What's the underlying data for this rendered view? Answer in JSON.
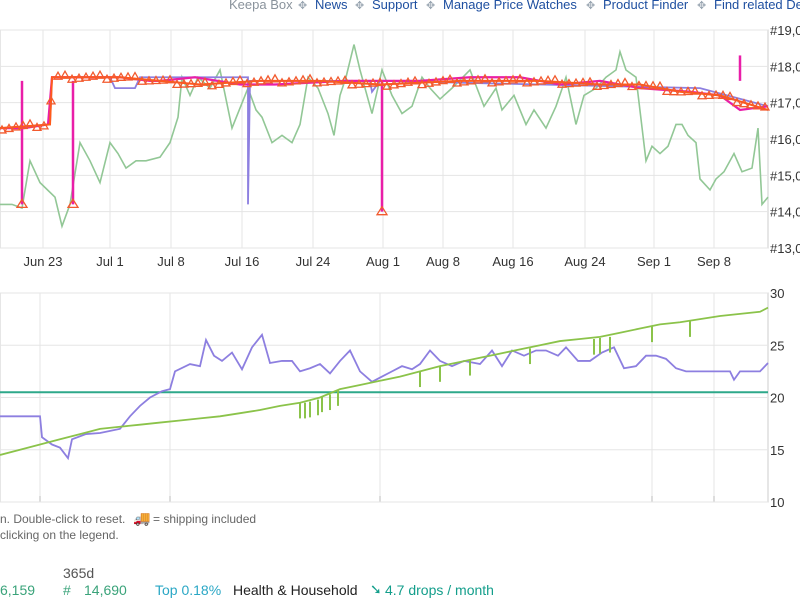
{
  "nav": {
    "items": [
      {
        "label": "Keepa Box",
        "color": "#8a939c"
      },
      {
        "label": "News",
        "color": "#1e4fa0"
      },
      {
        "label": "Support",
        "color": "#1e4fa0"
      },
      {
        "label": "Manage Price Watches",
        "color": "#1e4fa0"
      },
      {
        "label": "Product Finder",
        "color": "#1e4fa0"
      },
      {
        "label": "Find related De",
        "color": "#1e4fa0"
      }
    ]
  },
  "notes": {
    "line1": "n. Double-click to reset.",
    "shipping": "= shipping included",
    "line2": "clicking on the legend."
  },
  "stats": {
    "left_value": "6,159",
    "period": "365d",
    "rank_prefix": "#",
    "rank_value": "14,690",
    "top_percent": "Top 0.18%",
    "category": "Health & Household",
    "drops": "4.7 drops / month"
  },
  "chart_data": [
    {
      "type": "line",
      "name": "sales-rank",
      "x_ticks": [
        "Jun 23",
        "Jul 1",
        "Jul 8",
        "Jul 16",
        "Jul 24",
        "Aug 1",
        "Aug 8",
        "Aug 16",
        "Aug 24",
        "Sep 1",
        "Sep 8"
      ],
      "y_ticks": [
        "#19,0",
        "#18,0",
        "#17,0",
        "#16,0",
        "#15,0",
        "#14,0",
        "#13,0"
      ],
      "ylim": [
        13000,
        19000
      ],
      "series": [
        {
          "color": "#e91ea8",
          "points": [
            [
              0,
              16.3
            ],
            [
              8,
              16.3
            ],
            [
              12,
              16.3
            ],
            [
              24,
              16.3
            ],
            [
              48,
              16.4
            ],
            [
              52,
              17.7
            ],
            [
              74,
              17.7
            ],
            [
              80,
              17.7
            ],
            [
              120,
              17.7
            ],
            [
              150,
              17.6
            ],
            [
              160,
              17.6
            ],
            [
              195,
              17.7
            ],
            [
              240,
              17.5
            ],
            [
              275,
              17.5
            ],
            [
              345,
              17.6
            ],
            [
              380,
              17.6
            ],
            [
              420,
              17.6
            ],
            [
              470,
              17.7
            ],
            [
              520,
              17.7
            ],
            [
              560,
              17.5
            ],
            [
              600,
              17.6
            ],
            [
              640,
              17.4
            ],
            [
              690,
              17.3
            ],
            [
              720,
              17.2
            ],
            [
              740,
              16.8
            ],
            [
              768,
              16.9
            ]
          ],
          "spikes": [
            [
              22,
              14.2
            ],
            [
              73,
              14.2
            ],
            [
              382,
              14.0
            ],
            [
              740,
              18.3
            ]
          ]
        },
        {
          "color": "#ff5a1a",
          "points": [
            [
              0,
              16.3
            ],
            [
              50,
              16.4
            ],
            [
              52,
              17.7
            ],
            [
              120,
              17.7
            ],
            [
              200,
              17.5
            ],
            [
              260,
              17.6
            ],
            [
              320,
              17.6
            ],
            [
              380,
              17.5
            ],
            [
              460,
              17.6
            ],
            [
              540,
              17.6
            ],
            [
              600,
              17.5
            ],
            [
              640,
              17.5
            ],
            [
              680,
              17.3
            ],
            [
              720,
              17.2
            ],
            [
              768,
              16.8
            ]
          ]
        },
        {
          "color": "#8d7fe0",
          "points": [
            [
              0,
              16.3
            ],
            [
              50,
              16.4
            ],
            [
              52,
              17.7
            ],
            [
              110,
              17.7
            ],
            [
              115,
              17.4
            ],
            [
              135,
              17.4
            ],
            [
              140,
              17.7
            ],
            [
              248,
              17.7
            ],
            [
              248,
              14.2
            ],
            [
              250,
              17.6
            ],
            [
              370,
              17.6
            ],
            [
              372,
              17.3
            ],
            [
              380,
              17.6
            ],
            [
              700,
              17.4
            ],
            [
              768,
              16.9
            ]
          ]
        },
        {
          "color": "#92c796",
          "points": [
            [
              0,
              14.2
            ],
            [
              10,
              14.2
            ],
            [
              12,
              14.2
            ],
            [
              22,
              14.1
            ],
            [
              30,
              15.4
            ],
            [
              40,
              14.8
            ],
            [
              55,
              14.4
            ],
            [
              62,
              13.6
            ],
            [
              70,
              14.2
            ],
            [
              80,
              15.9
            ],
            [
              90,
              15.4
            ],
            [
              100,
              14.8
            ],
            [
              110,
              15.9
            ],
            [
              118,
              15.6
            ],
            [
              126,
              15.2
            ],
            [
              136,
              15.4
            ],
            [
              146,
              15.4
            ],
            [
              160,
              15.5
            ],
            [
              170,
              15.9
            ],
            [
              178,
              16.6
            ],
            [
              182,
              17.7
            ],
            [
              190,
              17.2
            ],
            [
              198,
              17.7
            ],
            [
              210,
              17.4
            ],
            [
              220,
              17.9
            ],
            [
              232,
              16.3
            ],
            [
              248,
              17.4
            ],
            [
              256,
              16.8
            ],
            [
              262,
              16.6
            ],
            [
              272,
              15.9
            ],
            [
              282,
              16.1
            ],
            [
              292,
              15.9
            ],
            [
              300,
              16.4
            ],
            [
              308,
              17.7
            ],
            [
              318,
              17.4
            ],
            [
              328,
              16.7
            ],
            [
              334,
              16.1
            ],
            [
              340,
              17.2
            ],
            [
              346,
              17.7
            ],
            [
              354,
              18.6
            ],
            [
              360,
              17.9
            ],
            [
              372,
              16.7
            ],
            [
              382,
              17.9
            ],
            [
              392,
              17.2
            ],
            [
              402,
              16.7
            ],
            [
              412,
              16.9
            ],
            [
              422,
              17.7
            ],
            [
              430,
              17.4
            ],
            [
              440,
              17.1
            ],
            [
              452,
              17.4
            ],
            [
              470,
              17.9
            ],
            [
              484,
              16.9
            ],
            [
              496,
              17.4
            ],
            [
              502,
              16.8
            ],
            [
              514,
              17.2
            ],
            [
              526,
              16.4
            ],
            [
              534,
              16.8
            ],
            [
              546,
              16.3
            ],
            [
              556,
              16.9
            ],
            [
              566,
              17.7
            ],
            [
              576,
              16.4
            ],
            [
              584,
              17.2
            ],
            [
              596,
              17.4
            ],
            [
              606,
              17.7
            ],
            [
              616,
              17.9
            ],
            [
              620,
              18.4
            ],
            [
              626,
              17.9
            ],
            [
              636,
              17.7
            ],
            [
              646,
              15.4
            ],
            [
              652,
              15.8
            ],
            [
              660,
              15.6
            ],
            [
              668,
              15.8
            ],
            [
              676,
              16.4
            ],
            [
              682,
              16.4
            ],
            [
              688,
              16.1
            ],
            [
              696,
              15.9
            ],
            [
              700,
              14.9
            ],
            [
              710,
              14.6
            ],
            [
              716,
              14.9
            ],
            [
              724,
              15.1
            ],
            [
              734,
              15.6
            ],
            [
              742,
              15.1
            ],
            [
              752,
              15.2
            ],
            [
              758,
              16.3
            ],
            [
              762,
              14.2
            ],
            [
              768,
              14.4
            ]
          ]
        }
      ]
    },
    {
      "type": "line",
      "name": "price",
      "y_ticks": [
        30,
        25,
        20,
        15,
        10
      ],
      "ylim": [
        10,
        30
      ],
      "series": [
        {
          "color": "#2ea88a",
          "points": [
            [
              0,
              20.5
            ],
            [
              768,
              20.5
            ]
          ]
        },
        {
          "color": "#8d7fe0",
          "points": [
            [
              0,
              18.2
            ],
            [
              40,
              18.2
            ],
            [
              42,
              16.2
            ],
            [
              52,
              15.5
            ],
            [
              60,
              15.2
            ],
            [
              68,
              14.2
            ],
            [
              72,
              16
            ],
            [
              86,
              16.5
            ],
            [
              100,
              16.6
            ],
            [
              120,
              17
            ],
            [
              130,
              18.2
            ],
            [
              140,
              19.2
            ],
            [
              150,
              20
            ],
            [
              162,
              20.6
            ],
            [
              170,
              20.8
            ],
            [
              175,
              22.5
            ],
            [
              190,
              23.2
            ],
            [
              200,
              23
            ],
            [
              206,
              25.5
            ],
            [
              214,
              24
            ],
            [
              222,
              23.5
            ],
            [
              232,
              24.3
            ],
            [
              242,
              22.7
            ],
            [
              252,
              24.8
            ],
            [
              262,
              26
            ],
            [
              270,
              23.3
            ],
            [
              282,
              23.5
            ],
            [
              292,
              23.5
            ],
            [
              300,
              22.5
            ],
            [
              310,
              22.8
            ],
            [
              320,
              23.2
            ],
            [
              330,
              22.3
            ],
            [
              340,
              23.5
            ],
            [
              350,
              24.5
            ],
            [
              360,
              22.5
            ],
            [
              372,
              21.5
            ],
            [
              382,
              22
            ],
            [
              392,
              22.5
            ],
            [
              402,
              23
            ],
            [
              412,
              22.7
            ],
            [
              420,
              23.2
            ],
            [
              430,
              24.5
            ],
            [
              440,
              23.5
            ],
            [
              452,
              23
            ],
            [
              464,
              23.5
            ],
            [
              480,
              23.2
            ],
            [
              492,
              24.5
            ],
            [
              502,
              23
            ],
            [
              512,
              24.5
            ],
            [
              524,
              24
            ],
            [
              536,
              24.5
            ],
            [
              546,
              24.5
            ],
            [
              558,
              24
            ],
            [
              566,
              24.8
            ],
            [
              578,
              23.5
            ],
            [
              590,
              23.5
            ],
            [
              602,
              24.3
            ],
            [
              614,
              24.8
            ],
            [
              624,
              22.8
            ],
            [
              636,
              23
            ],
            [
              646,
              24
            ],
            [
              656,
              24
            ],
            [
              666,
              23.7
            ],
            [
              676,
              22.8
            ],
            [
              686,
              22.5
            ],
            [
              696,
              22.5
            ],
            [
              710,
              22.5
            ],
            [
              730,
              22.5
            ],
            [
              734,
              21.7
            ],
            [
              740,
              22.5
            ],
            [
              760,
              22.5
            ],
            [
              768,
              23.3
            ]
          ]
        },
        {
          "color": "#8bc34a",
          "points": [
            [
              0,
              14.5
            ],
            [
              20,
              15
            ],
            [
              40,
              15.5
            ],
            [
              60,
              16
            ],
            [
              80,
              16.5
            ],
            [
              100,
              17
            ],
            [
              120,
              17.2
            ],
            [
              140,
              17.4
            ],
            [
              160,
              17.6
            ],
            [
              180,
              17.8
            ],
            [
              200,
              18
            ],
            [
              220,
              18.2
            ],
            [
              240,
              18.5
            ],
            [
              260,
              18.8
            ],
            [
              280,
              19.2
            ],
            [
              300,
              19.5
            ],
            [
              320,
              20
            ],
            [
              340,
              20.8
            ],
            [
              360,
              21.2
            ],
            [
              380,
              21.6
            ],
            [
              400,
              22
            ],
            [
              420,
              22.5
            ],
            [
              440,
              23
            ],
            [
              460,
              23.4
            ],
            [
              480,
              23.8
            ],
            [
              500,
              24.2
            ],
            [
              520,
              24.6
            ],
            [
              540,
              25
            ],
            [
              560,
              25.4
            ],
            [
              580,
              25.6
            ],
            [
              600,
              25.8
            ],
            [
              620,
              26.2
            ],
            [
              640,
              26.6
            ],
            [
              660,
              27
            ],
            [
              680,
              27.2
            ],
            [
              700,
              27.5
            ],
            [
              720,
              27.8
            ],
            [
              740,
              28
            ],
            [
              760,
              28.2
            ],
            [
              768,
              28.6
            ]
          ]
        }
      ]
    }
  ]
}
